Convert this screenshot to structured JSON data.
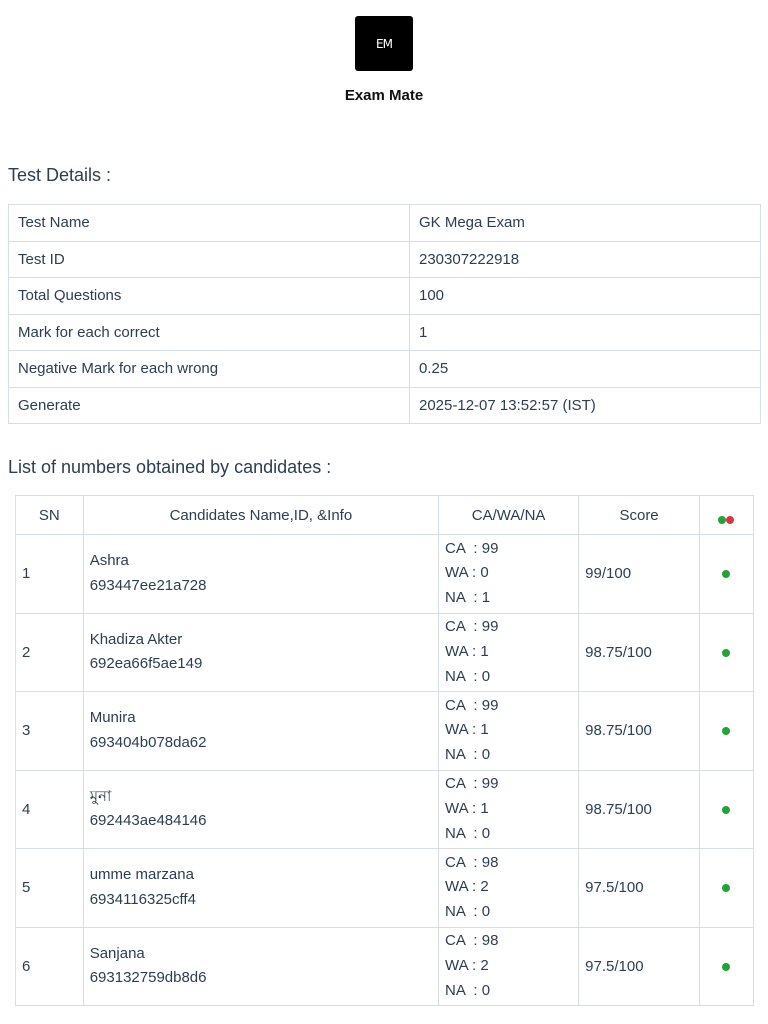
{
  "app": {
    "logo_text": "EM",
    "name": "Exam Mate"
  },
  "test_details": {
    "heading": "Test Details :",
    "rows": [
      {
        "label": "Test Name",
        "value": "GK Mega Exam"
      },
      {
        "label": "Test ID",
        "value": "230307222918"
      },
      {
        "label": "Total Questions",
        "value": "100"
      },
      {
        "label": "Mark for each correct",
        "value": "1"
      },
      {
        "label": "Negative Mark for each wrong",
        "value": "0.25"
      },
      {
        "label": "Generate",
        "value": "2025-12-07 13:52:57 (IST)"
      }
    ]
  },
  "results": {
    "heading": "List of numbers obtained by candidates :",
    "columns": {
      "sn": "SN",
      "name": "Candidates Name,ID, &Info",
      "stats": "CA/WA/NA",
      "score": "Score"
    },
    "colors": {
      "green": "#22a336",
      "red": "#d9363e"
    },
    "rows": [
      {
        "sn": "1",
        "name": "Ashra",
        "id": "693447ee21a728",
        "ca": "CA  : 99",
        "wa": "WA : 0",
        "na": "NA  : 1",
        "score": "99/100",
        "status": "green"
      },
      {
        "sn": "2",
        "name": "Khadiza Akter",
        "id": "692ea66f5ae149",
        "ca": "CA  : 99",
        "wa": "WA : 1",
        "na": "NA  : 0",
        "score": "98.75/100",
        "status": "green"
      },
      {
        "sn": "3",
        "name": "Munira",
        "id": "693404b078da62",
        "ca": "CA  : 99",
        "wa": "WA : 1",
        "na": "NA  : 0",
        "score": "98.75/100",
        "status": "green"
      },
      {
        "sn": "4",
        "name": "মুনা",
        "id": "692443ae484146",
        "ca": "CA  : 99",
        "wa": "WA : 1",
        "na": "NA  : 0",
        "score": "98.75/100",
        "status": "green"
      },
      {
        "sn": "5",
        "name": "umme marzana",
        "id": "6934116325cff4",
        "ca": "CA  : 98",
        "wa": "WA : 2",
        "na": "NA  : 0",
        "score": "97.5/100",
        "status": "green"
      },
      {
        "sn": "6",
        "name": "Sanjana",
        "id": "693132759db8d6",
        "ca": "CA  : 98",
        "wa": "WA : 2",
        "na": "NA  : 0",
        "score": "97.5/100",
        "status": "green"
      }
    ]
  }
}
